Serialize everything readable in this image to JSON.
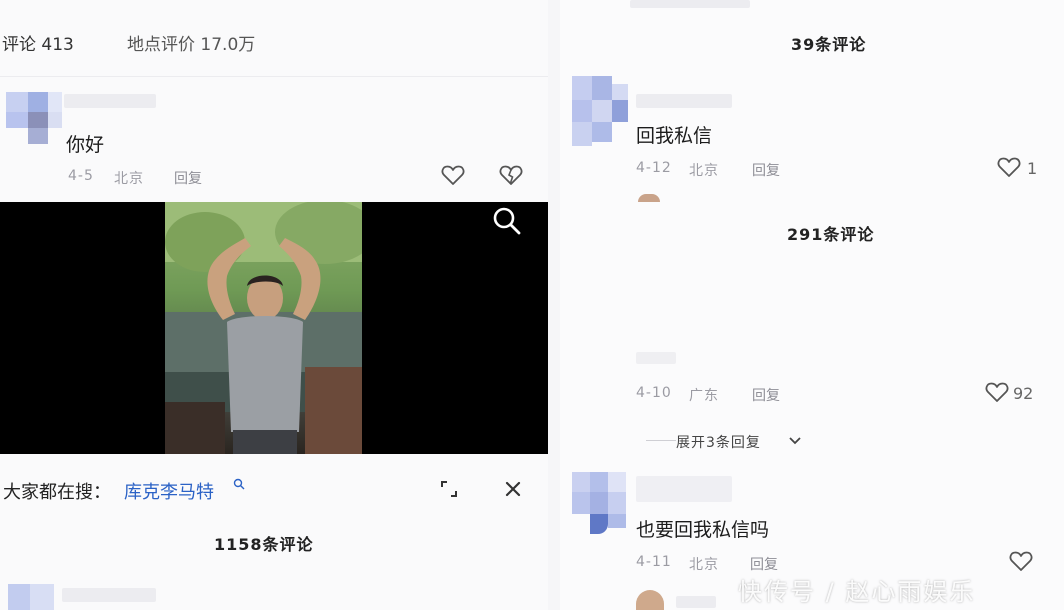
{
  "tabs": {
    "comments_label": "评论 413",
    "location_label": "地点评价 17.0万"
  },
  "left": {
    "comment": {
      "text": "你好",
      "date": "4-5",
      "location": "北京",
      "reply": "回复"
    },
    "search": {
      "label": "大家都在搜：",
      "query": "库克李马特"
    },
    "count_label": "1158条评论"
  },
  "right": {
    "top_count": "39条评论",
    "comment1": {
      "text": "回我私信",
      "date": "4-12",
      "location": "北京",
      "reply": "回复",
      "likes": "1"
    },
    "count2": "291条评论",
    "comment2": {
      "date": "4-10",
      "location": "广东",
      "reply": "回复",
      "likes": "92"
    },
    "expand_label": "展开3条回复",
    "comment3": {
      "text": "也要回我私信吗",
      "date": "4-11",
      "location": "北京",
      "reply": "回复"
    }
  },
  "watermark": "快传号 / 赵心雨娱乐",
  "colors": {
    "link": "#2b62c6",
    "video_bg": "#000000",
    "avatar_blue": "#aab8e6"
  }
}
